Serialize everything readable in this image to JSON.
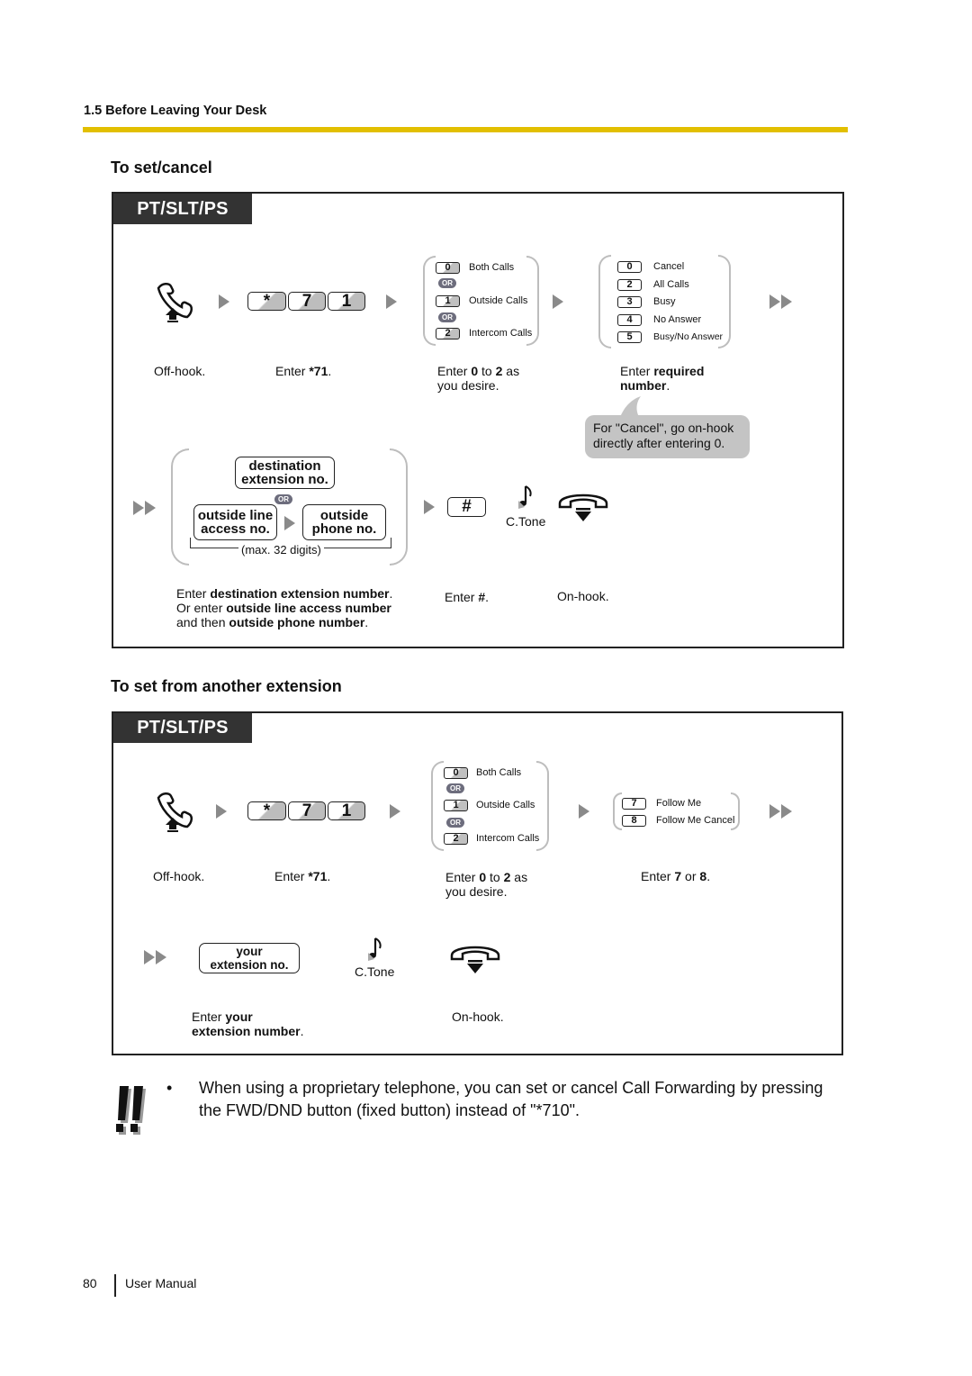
{
  "header": {
    "section": "1.5 Before Leaving Your Desk",
    "accent_color": "#e2bf00"
  },
  "section1": {
    "title": "To set/cancel",
    "tab": "PT/SLT/PS",
    "keys": [
      "*",
      "7",
      "1"
    ],
    "captions": {
      "offhook": "Off-hook.",
      "enter_prefix": "Enter ",
      "enter_code": "*71",
      "enter_suffix": ".",
      "range_pre": "Enter ",
      "range_a": "0",
      "range_mid": " to ",
      "range_b": "2",
      "range_post": " as",
      "range_line2": "you desire.",
      "req_pre": "Enter ",
      "req_bold1": "required",
      "req_bold2": "number",
      "req_post": "."
    },
    "call_type_options": [
      {
        "key": "0",
        "label": "Both Calls"
      },
      {
        "key": "1",
        "label": "Outside Calls"
      },
      {
        "key": "2",
        "label": "Intercom Calls"
      }
    ],
    "or_label": "OR",
    "forward_options": [
      {
        "key": "0",
        "label": "Cancel"
      },
      {
        "key": "2",
        "label": "All Calls"
      },
      {
        "key": "3",
        "label": "Busy"
      },
      {
        "key": "4",
        "label": "No Answer"
      },
      {
        "key": "5",
        "label": "Busy/No Answer"
      }
    ],
    "bubble": {
      "line1": "For \"Cancel\", go on-hook",
      "line2": "directly after entering 0."
    },
    "destination_box": {
      "line1": "destination",
      "line2": "extension no."
    },
    "outside_line_box": {
      "line1": "outside line",
      "line2": "access no."
    },
    "outside_phone_box": {
      "line1": "outside",
      "line2": "phone no."
    },
    "max_digits": "(max. 32 digits)",
    "hash_key": "#",
    "ctone": "C.Tone",
    "dest_caption": {
      "l1_pre": "Enter ",
      "l1_bold": "destination extension number",
      "l1_post": ".",
      "l2_pre": "Or enter ",
      "l2_bold": "outside line access number",
      "l3_pre": "and then ",
      "l3_bold": "outside phone number",
      "l3_post": "."
    },
    "hash_caption_pre": "Enter ",
    "hash_caption_bold": "#",
    "hash_caption_post": ".",
    "onhook": "On-hook."
  },
  "section2": {
    "title": "To set from another extension",
    "tab": "PT/SLT/PS",
    "keys": [
      "*",
      "7",
      "1"
    ],
    "call_type_options": [
      {
        "key": "0",
        "label": "Both Calls"
      },
      {
        "key": "1",
        "label": "Outside Calls"
      },
      {
        "key": "2",
        "label": "Intercom Calls"
      }
    ],
    "or_label": "OR",
    "follow_options": [
      {
        "key": "7",
        "label": "Follow Me"
      },
      {
        "key": "8",
        "label": "Follow Me Cancel"
      }
    ],
    "captions": {
      "offhook": "Off-hook.",
      "enter_prefix": "Enter ",
      "enter_code": "*71",
      "enter_suffix": ".",
      "range_pre": "Enter ",
      "range_a": "0",
      "range_mid": " to ",
      "range_b": "2",
      "range_post": " as",
      "range_line2": "you desire.",
      "follow_pre": "Enter ",
      "follow_a": "7",
      "follow_mid": " or ",
      "follow_b": "8",
      "follow_post": "."
    },
    "your_ext_box": {
      "line1": "your",
      "line2": "extension no."
    },
    "ctone": "C.Tone",
    "your_caption": {
      "l1_pre": "Enter ",
      "l1_bold": "your",
      "l2_bold": "extension number",
      "l2_post": "."
    },
    "onhook": "On-hook."
  },
  "note": {
    "bullet": "•",
    "line1": "When using a proprietary telephone, you can set or cancel Call Forwarding by pressing",
    "line2": "the FWD/DND button (fixed button) instead of \"*710\"."
  },
  "footer": {
    "page_number": "80",
    "label": "User Manual"
  }
}
